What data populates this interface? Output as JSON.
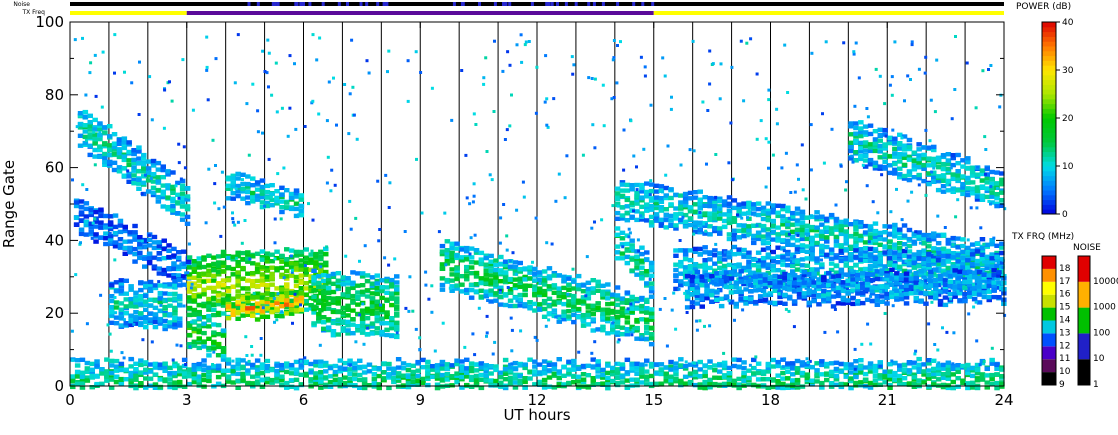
{
  "chart_data": {
    "type": "heatmap",
    "xlabel": "UT hours",
    "ylabel": "Range Gate",
    "xlim": [
      0,
      24
    ],
    "ylim": [
      0,
      100
    ],
    "x_ticks": [
      "0",
      "3",
      "6",
      "9",
      "12",
      "15",
      "18",
      "21",
      "24"
    ],
    "x_tick_values": [
      0,
      3,
      6,
      9,
      12,
      15,
      18,
      21,
      24
    ],
    "y_ticks": [
      "0",
      "20",
      "40",
      "60",
      "80",
      "100"
    ],
    "y_tick_values": [
      0,
      20,
      40,
      60,
      80,
      100
    ],
    "scan_boundaries_ut": [
      1,
      2,
      3,
      4,
      5,
      6,
      7,
      8,
      9,
      10,
      11,
      12,
      13,
      14,
      15,
      16,
      17,
      18,
      19,
      20,
      21,
      22,
      23
    ],
    "status_bars": {
      "noise_label": "Noise",
      "txfreq_label": "TX Freq",
      "txfreq_segments": [
        {
          "start": 0,
          "end": 3,
          "mhz": 14.5,
          "color": "#ffff00"
        },
        {
          "start": 3,
          "end": 15,
          "mhz": 11,
          "color": "#5a0a9a"
        },
        {
          "start": 15,
          "end": 24,
          "mhz": 14.5,
          "color": "#ffff00"
        }
      ]
    },
    "echo_regions": [
      {
        "name": "band-0-2h",
        "ut_start": 0.2,
        "ut_end": 3.0,
        "gate_start": 72,
        "gate_end": 50,
        "width": 5,
        "power": 12
      },
      {
        "name": "band-0-3h-low",
        "ut_start": 0.1,
        "ut_end": 3.0,
        "gate_start": 48,
        "gate_end": 32,
        "width": 4,
        "power": 6
      },
      {
        "name": "patch-1-2h",
        "ut_start": 1.0,
        "ut_end": 2.8,
        "gate_start": 23,
        "gate_end": 23,
        "width": 6,
        "power": 11
      },
      {
        "name": "patch-3-7h",
        "ut_start": 3.0,
        "ut_end": 6.6,
        "gate_start": 28,
        "gate_end": 30,
        "width": 8,
        "power": 26
      },
      {
        "name": "core-4-6h",
        "ut_start": 4.0,
        "ut_end": 6.0,
        "gate_start": 22,
        "gate_end": 24,
        "width": 3,
        "power": 34
      },
      {
        "name": "patch-3-4h-low",
        "ut_start": 3.0,
        "ut_end": 4.0,
        "gate_start": 16,
        "gate_end": 12,
        "width": 4,
        "power": 20
      },
      {
        "name": "patch-6-8h",
        "ut_start": 6.2,
        "ut_end": 8.4,
        "gate_start": 24,
        "gate_end": 22,
        "width": 8,
        "power": 18
      },
      {
        "name": "patch-4-6h-top",
        "ut_start": 4.0,
        "ut_end": 6.0,
        "gate_start": 56,
        "gate_end": 50,
        "width": 3,
        "power": 12
      },
      {
        "name": "band-9-15h",
        "ut_start": 9.5,
        "ut_end": 15.0,
        "gate_start": 34,
        "gate_end": 18,
        "width": 6,
        "power": 16
      },
      {
        "name": "band-13-15h-mid",
        "ut_start": 14.0,
        "ut_end": 15.0,
        "gate_start": 40,
        "gate_end": 30,
        "width": 4,
        "power": 14
      },
      {
        "name": "band-15-24h-a",
        "ut_start": 14.0,
        "ut_end": 24.0,
        "gate_start": 52,
        "gate_end": 34,
        "width": 5,
        "power": 12
      },
      {
        "name": "band-16-24h-b",
        "ut_start": 15.5,
        "ut_end": 24.0,
        "gate_start": 33,
        "gate_end": 32,
        "width": 5,
        "power": 10
      },
      {
        "name": "band-16-24h-c",
        "ut_start": 15.8,
        "ut_end": 24.0,
        "gate_start": 27,
        "gate_end": 28,
        "width": 4,
        "power": 8
      },
      {
        "name": "band-20-24h-top",
        "ut_start": 20.0,
        "ut_end": 24.0,
        "gate_start": 68,
        "gate_end": 54,
        "width": 5,
        "power": 12
      },
      {
        "name": "ground-0-24h",
        "ut_start": 0.0,
        "ut_end": 24.0,
        "gate_start": 2,
        "gate_end": 2,
        "width": 5,
        "power": 14
      }
    ],
    "power_colorbar": {
      "title": "POWER (dB)",
      "ticks": [
        "0",
        "10",
        "20",
        "30",
        "40"
      ],
      "tick_values": [
        0,
        10,
        20,
        30,
        40
      ],
      "range": [
        0,
        40
      ]
    },
    "txfreq_colorbar": {
      "title": "TX FRQ (MHz)",
      "ticks": [
        "9",
        "10",
        "11",
        "12",
        "13",
        "14",
        "15",
        "16",
        "17",
        "18"
      ],
      "tick_values": [
        9,
        10,
        11,
        12,
        13,
        14,
        15,
        16,
        17,
        18
      ],
      "colors": [
        "#000000",
        "#5a0a5a",
        "#4a00c8",
        "#0050ff",
        "#00c8e0",
        "#00c000",
        "#c8e000",
        "#ffff00",
        "#ff9000",
        "#e00000"
      ]
    },
    "noise_colorbar": {
      "title": "NOISE",
      "ticks": [
        "1",
        "10",
        "100",
        "1000",
        "10000"
      ],
      "tick_values": [
        1,
        10,
        100,
        1000,
        10000
      ],
      "colors": [
        "#000000",
        "#2020c8",
        "#00c000",
        "#ffb000",
        "#e00000"
      ]
    }
  }
}
